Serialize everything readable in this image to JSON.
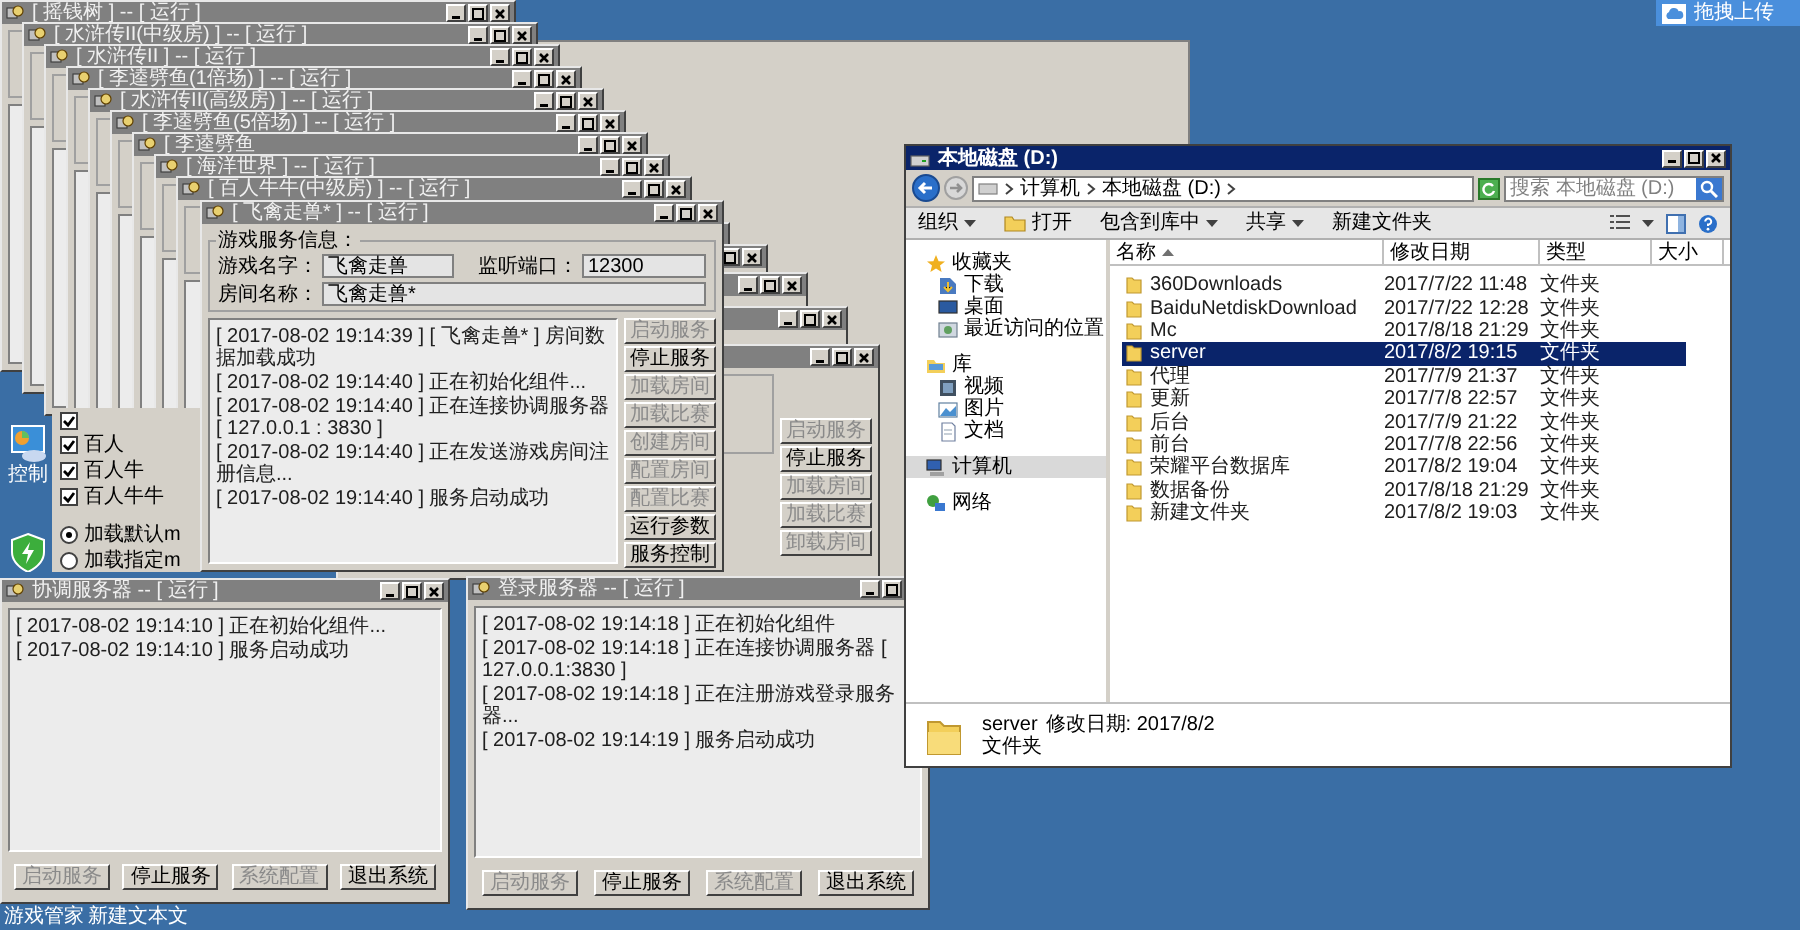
{
  "upload_button": {
    "label": "拖拽上传"
  },
  "desktop_icons": [
    {
      "kind": "panel",
      "label": "控制"
    },
    {
      "kind": "shield"
    }
  ],
  "desktop_labels": [
    "游戏管家",
    "新建文本文"
  ],
  "cascade_windows": [
    {
      "title": "[ 摇钱树 ] -- [ 运行 ]"
    },
    {
      "title": "[ 水浒传II(中级房) ] -- [ 运行 ]"
    },
    {
      "title": "[ 水浒传II ] -- [ 运行 ]"
    },
    {
      "title": "[ 李逵劈鱼(1倍场) ] -- [ 运行 ]"
    },
    {
      "title": "[ 水浒传II(高级房) ] -- [ 运行 ]"
    },
    {
      "title": "[ 李逵劈鱼(5倍场) ] -- [ 运行 ]"
    },
    {
      "title": "[ 李逵劈鱼"
    },
    {
      "title": "[ 海洋世界 ] -- [ 运行 ]"
    },
    {
      "title": "[ 百人牛牛(中级房) ] -- [ 运行 ]"
    }
  ],
  "options_panel": {
    "checkboxes": [
      {
        "checked": true
      },
      {
        "label": "百人",
        "checked": true
      },
      {
        "label": "百人牛",
        "checked": true
      },
      {
        "label": "百人牛牛",
        "checked": true
      }
    ],
    "radios": [
      {
        "label": "加载默认m",
        "selected": true
      },
      {
        "label": "加载指定m",
        "selected": false
      }
    ]
  },
  "back_window": {
    "buttons": [
      {
        "label": "启动服务",
        "disabled": true
      },
      {
        "label": "停止服务",
        "disabled": false
      },
      {
        "label": "加载房间",
        "disabled": true
      },
      {
        "label": "加载比赛",
        "disabled": true
      },
      {
        "label": "卸载房间",
        "disabled": true
      }
    ]
  },
  "front_window": {
    "title": "[ 飞禽走兽* ] -- [ 运行 ]",
    "group_title": "游戏服务信息：",
    "fields": [
      {
        "label": "游戏名字：",
        "value": "飞禽走兽"
      },
      {
        "label": "监听端口：",
        "value": "12300"
      },
      {
        "label": "房间名称：",
        "value": "飞禽走兽*"
      }
    ],
    "log": [
      "[ 2017-08-02 19:14:39 ] [ 飞禽走兽* ] 房间数据加载成功",
      "[ 2017-08-02 19:14:40 ] 正在初始化组件...",
      "[ 2017-08-02 19:14:40 ] 正在连接协调服务器 [ 127.0.0.1 : 3830 ]",
      "[ 2017-08-02 19:14:40 ] 正在发送游戏房间注册信息...",
      "[ 2017-08-02 19:14:40 ] 服务启动成功"
    ],
    "buttons": [
      {
        "label": "启动服务",
        "disabled": true
      },
      {
        "label": "停止服务",
        "disabled": false
      },
      {
        "label": "加载房间",
        "disabled": true
      },
      {
        "label": "加载比赛",
        "disabled": true
      },
      {
        "label": "创建房间",
        "disabled": true
      },
      {
        "label": "配置房间",
        "disabled": true
      },
      {
        "label": "配置比赛",
        "disabled": true
      },
      {
        "label": "运行参数",
        "disabled": false
      },
      {
        "label": "服务控制",
        "disabled": false
      }
    ]
  },
  "coord_window": {
    "title": "协调服务器 -- [ 运行 ]",
    "log": [
      "[ 2017-08-02 19:14:10 ] 正在初始化组件...",
      "[ 2017-08-02 19:14:10 ] 服务启动成功"
    ],
    "buttons": [
      {
        "label": "启动服务",
        "disabled": true
      },
      {
        "label": "停止服务",
        "disabled": false
      },
      {
        "label": "系统配置",
        "disabled": true
      },
      {
        "label": "退出系统",
        "disabled": false
      }
    ]
  },
  "login_window": {
    "title": "登录服务器 -- [ 运行 ]",
    "log": [
      "[ 2017-08-02 19:14:18 ] 正在初始化组件",
      "[ 2017-08-02 19:14:18 ] 正在连接协调服务器 [ 127.0.0.1:3830 ]",
      "[ 2017-08-02 19:14:18 ] 正在注册游戏登录服务器...",
      "[ 2017-08-02 19:14:19 ] 服务启动成功"
    ],
    "buttons": [
      {
        "label": "启动服务",
        "disabled": true
      },
      {
        "label": "停止服务",
        "disabled": false
      },
      {
        "label": "系统配置",
        "disabled": true
      },
      {
        "label": "退出系统",
        "disabled": false
      }
    ]
  },
  "explorer": {
    "title": "本地磁盘 (D:)",
    "address": [
      "计算机",
      "本地磁盘 (D:)"
    ],
    "search": {
      "placeholder": "搜索 本地磁盘 (D:)"
    },
    "toolbar": [
      {
        "label": "组织",
        "kind": "menu"
      },
      {
        "label": "打开",
        "kind": "action"
      },
      {
        "label": "包含到库中",
        "kind": "menu"
      },
      {
        "label": "共享",
        "kind": "menu"
      },
      {
        "label": "新建文件夹",
        "kind": "plain"
      }
    ],
    "sidebar": [
      {
        "label": "收藏夹",
        "kind": "favorites",
        "selected": false,
        "children": [
          {
            "label": "下载",
            "kind": "downloads",
            "selected": false
          },
          {
            "label": "桌面",
            "kind": "desktop",
            "selected": false
          },
          {
            "label": "最近访问的位置",
            "kind": "recent",
            "selected": false
          }
        ]
      },
      {
        "label": "库",
        "kind": "libraries",
        "selected": false,
        "children": [
          {
            "label": "视频",
            "kind": "videos",
            "selected": false
          },
          {
            "label": "图片",
            "kind": "pictures",
            "selected": false
          },
          {
            "label": "文档",
            "kind": "documents",
            "selected": false
          }
        ]
      },
      {
        "label": "计算机",
        "kind": "computer",
        "selected": true
      },
      {
        "label": "网络",
        "kind": "network",
        "selected": false
      }
    ],
    "columns": [
      {
        "label": "名称",
        "sorted": true
      },
      {
        "label": "修改日期",
        "sorted": false
      },
      {
        "label": "类型",
        "sorted": false
      },
      {
        "label": "大小",
        "sorted": false
      }
    ],
    "rows": [
      {
        "name": "360Downloads",
        "date": "2017/7/22 11:48",
        "type": "文件夹",
        "selected": false
      },
      {
        "name": "BaiduNetdiskDownload",
        "date": "2017/7/22 12:28",
        "type": "文件夹",
        "selected": false
      },
      {
        "name": "Mc",
        "date": "2017/8/18 21:29",
        "type": "文件夹",
        "selected": false
      },
      {
        "name": "server",
        "date": "2017/8/2 19:15",
        "type": "文件夹",
        "selected": true
      },
      {
        "name": "代理",
        "date": "2017/7/9 21:37",
        "type": "文件夹",
        "selected": false
      },
      {
        "name": "更新",
        "date": "2017/7/8 22:57",
        "type": "文件夹",
        "selected": false
      },
      {
        "name": "后台",
        "date": "2017/7/9 21:22",
        "type": "文件夹",
        "selected": false
      },
      {
        "name": "前台",
        "date": "2017/7/8 22:56",
        "type": "文件夹",
        "selected": false
      },
      {
        "name": "荣耀平台数据库",
        "date": "2017/8/2 19:04",
        "type": "文件夹",
        "selected": false
      },
      {
        "name": "数据备份",
        "date": "2017/8/18 21:29",
        "type": "文件夹",
        "selected": false
      },
      {
        "name": "新建文件夹",
        "date": "2017/8/2 19:03",
        "type": "文件夹",
        "selected": false
      }
    ],
    "details": {
      "name": "server",
      "modified": "修改日期: 2017/8/2",
      "type": "文件夹"
    }
  }
}
